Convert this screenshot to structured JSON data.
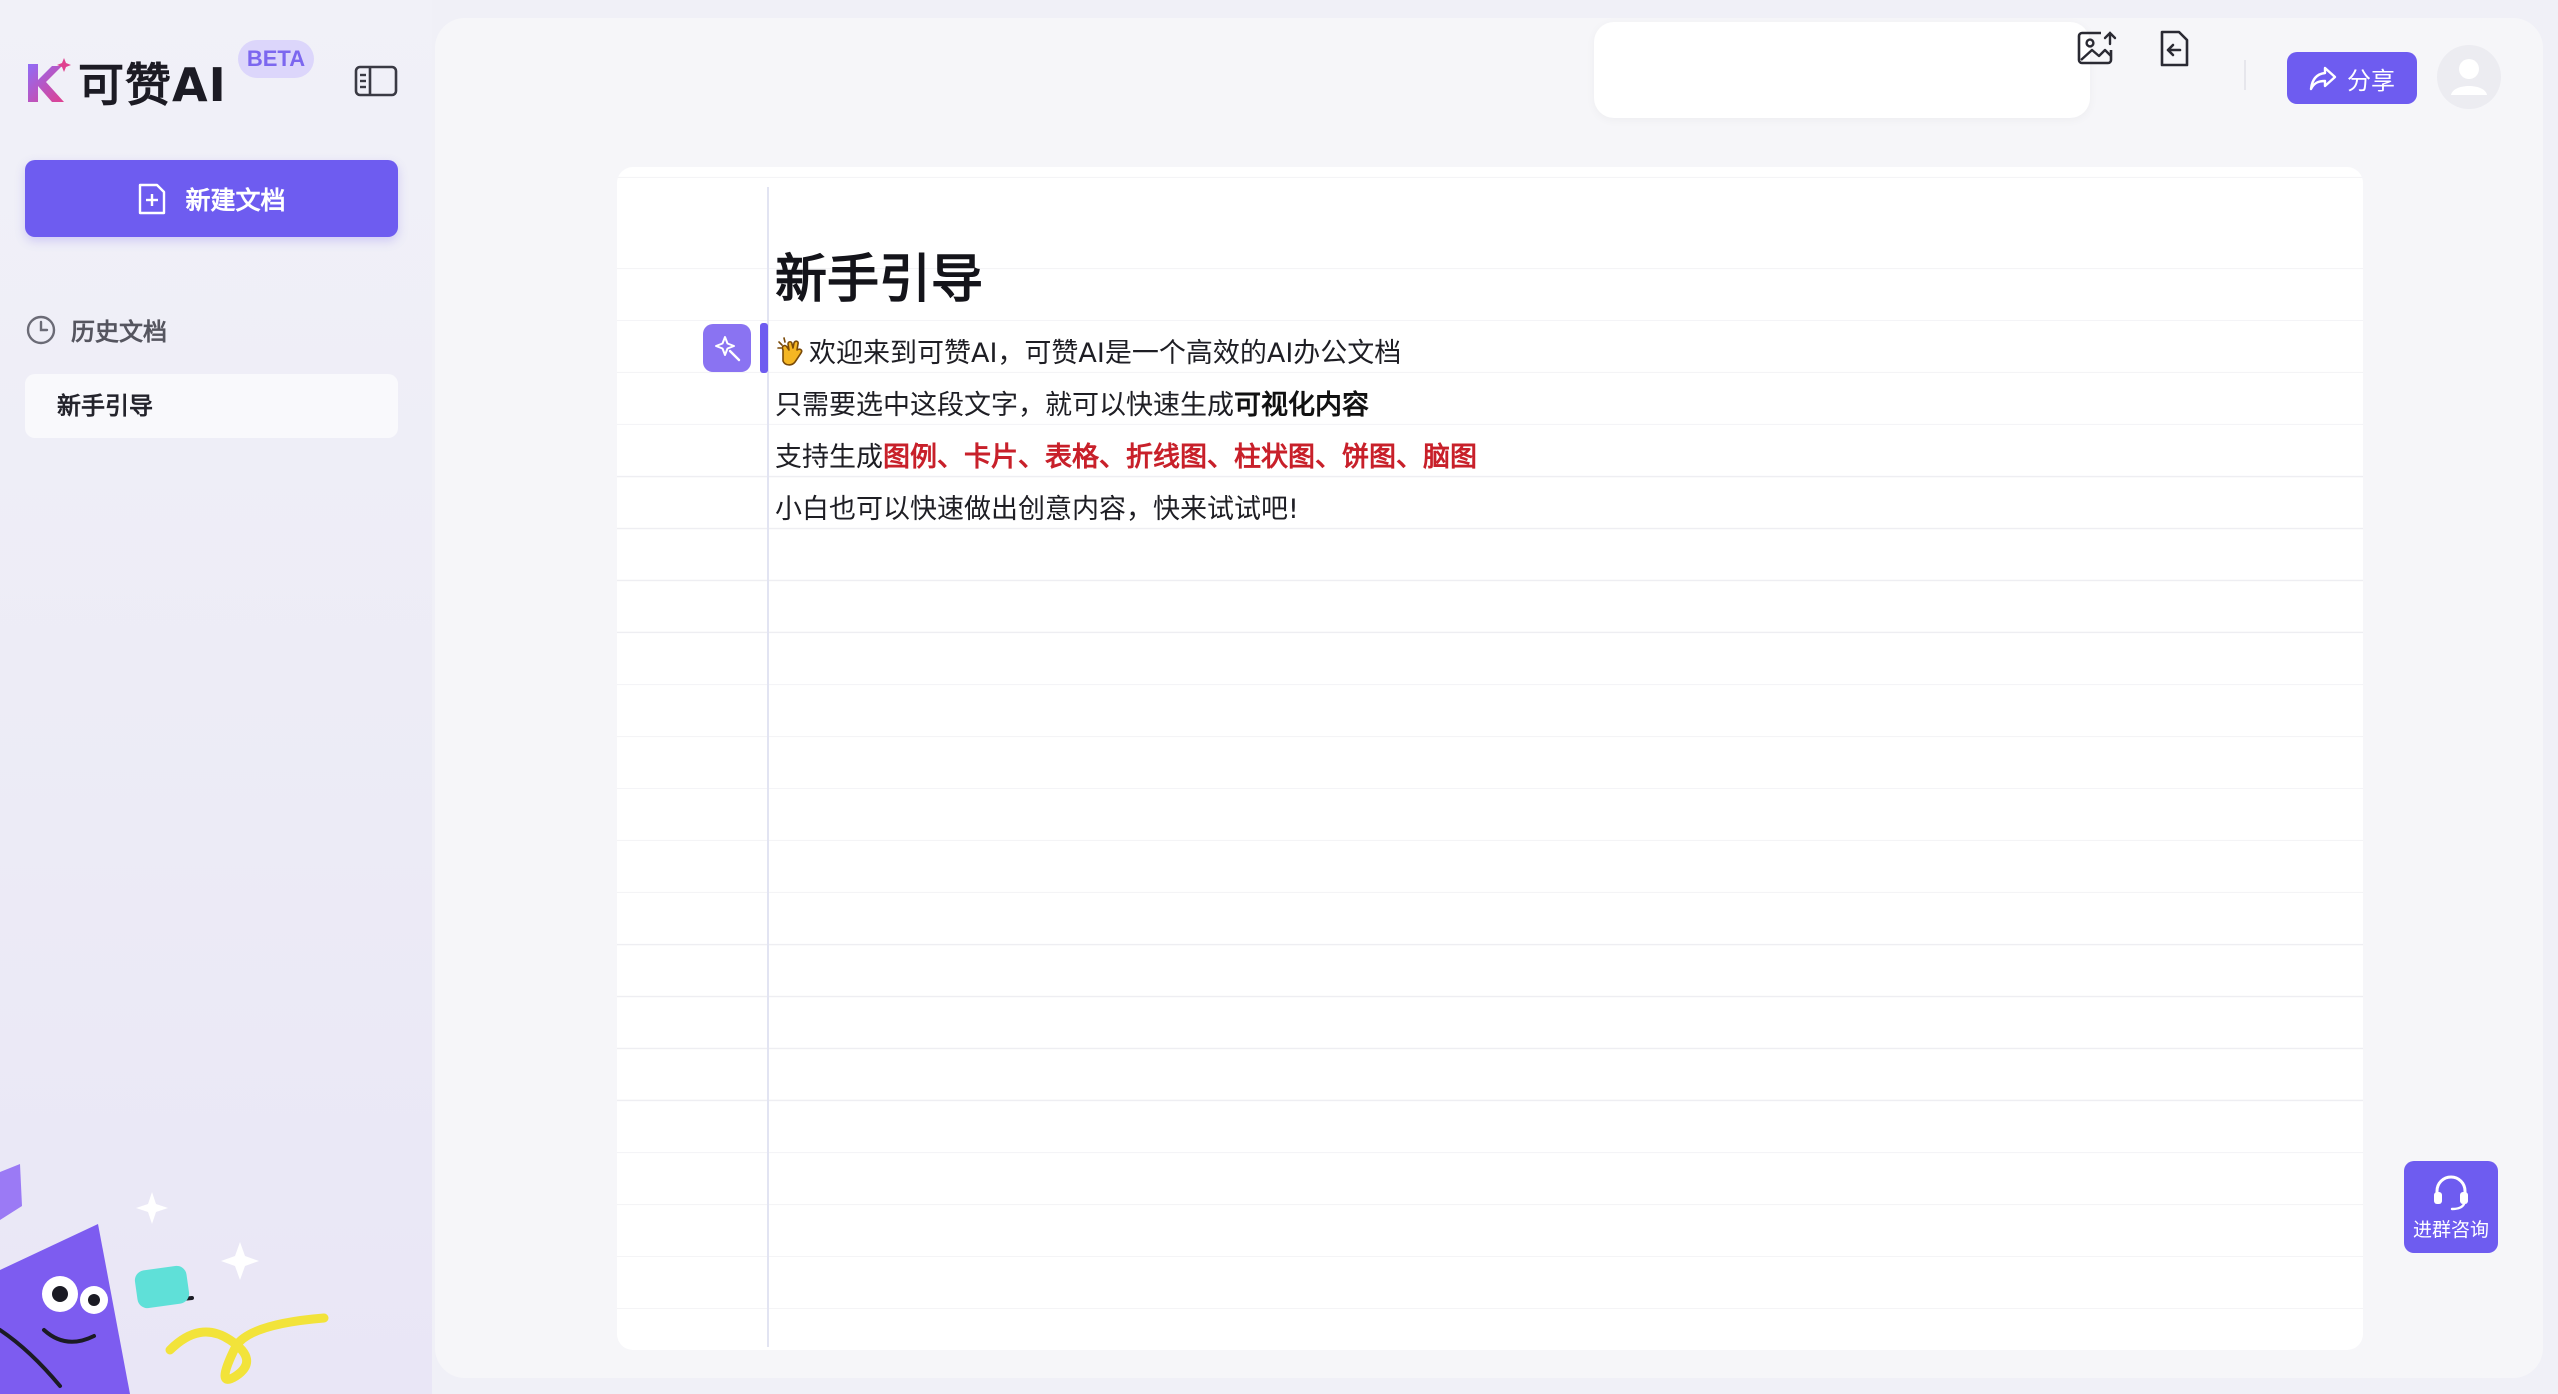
{
  "app": {
    "brand_name": "可赞AI",
    "beta_badge": "BETA"
  },
  "sidebar": {
    "new_doc_label": "新建文档",
    "history_title": "历史文档",
    "history_items": [
      {
        "label": "新手引导"
      }
    ]
  },
  "toolbar": {
    "share_label": "分享"
  },
  "document": {
    "title": "新手引导",
    "lines": [
      {
        "text": "欢迎来到可赞AI，可赞AI是一个高效的AI办公文档"
      },
      {
        "prefix": "只需要选中这段文字，就可以快速生成",
        "bold": "可视化内容"
      },
      {
        "prefix": "支持生成",
        "highlight": "图例、卡片、表格、折线图、柱状图、饼图、脑图"
      },
      {
        "text": "小白也可以快速做出创意内容，快来试试吧!"
      }
    ]
  },
  "consult": {
    "label": "进群咨询"
  },
  "colors": {
    "accent": "#6e5cf0",
    "highlight_red": "#c8202a",
    "beta_bg": "#dcd6fb"
  },
  "icons": {
    "collapse": "sidebar-collapse-icon",
    "new_doc": "file-plus-icon",
    "history": "clock-icon",
    "image_export": "image-export-icon",
    "file_import": "file-import-icon",
    "share": "share-arrow-icon",
    "avatar": "user-avatar-icon",
    "ai_magic": "magic-wand-icon",
    "consult": "headset-icon"
  }
}
